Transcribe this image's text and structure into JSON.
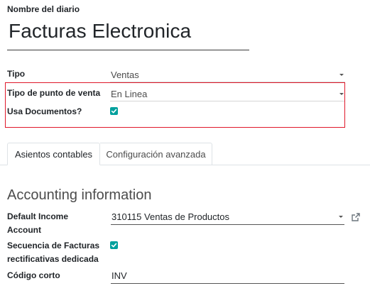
{
  "header": {
    "label": "Nombre del diario",
    "journal_name": "Facturas Electronica"
  },
  "fields": {
    "tipo": {
      "label": "Tipo",
      "value": "Ventas"
    },
    "tipo_punto_venta": {
      "label": "Tipo de punto de venta",
      "value": "En Linea"
    },
    "usa_documentos": {
      "label": "Usa Documentos?",
      "checked": true
    }
  },
  "tabs": [
    {
      "label": "Asientos contables",
      "active": true
    },
    {
      "label": "Configuración avanzada",
      "active": false
    }
  ],
  "accounting": {
    "section_title": "Accounting information",
    "default_income_account": {
      "label_line1": "Default Income",
      "label_line2": "Account",
      "value": "310115 Ventas de Productos"
    },
    "secuencia": {
      "label_line1": "Secuencia de Facturas",
      "label_line2": "rectificativas dedicada",
      "checked": true
    },
    "codigo_corto": {
      "label": "Código corto",
      "value": "INV"
    }
  },
  "colors": {
    "checkbox": "#00a09d",
    "highlight_border": "#e0182a"
  },
  "icons": {
    "dropdown": "caret-down-icon",
    "external_link": "external-link-icon",
    "check": "check-icon"
  }
}
